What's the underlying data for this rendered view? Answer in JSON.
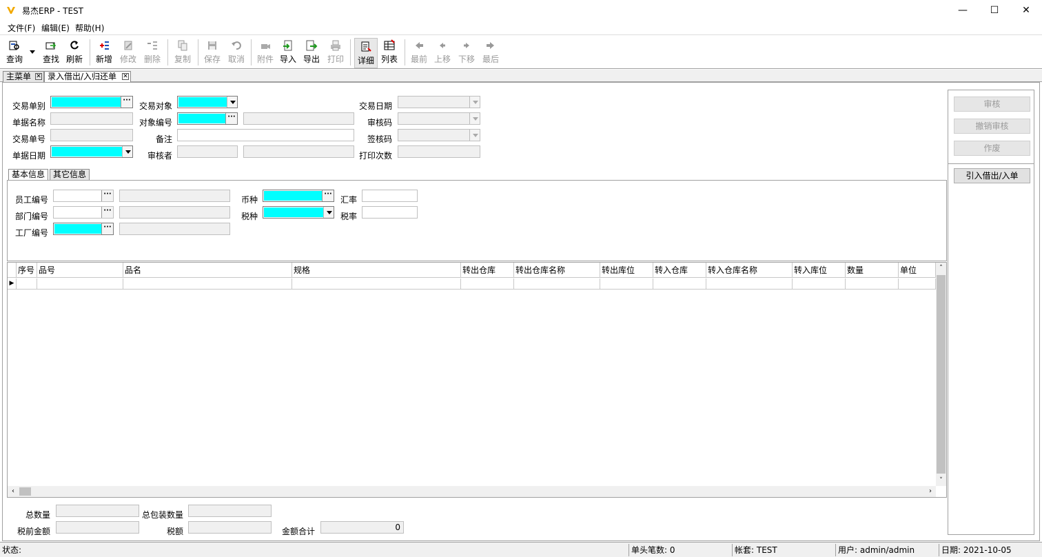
{
  "window": {
    "title": "易杰ERP - TEST",
    "min_glyph": "—",
    "max_glyph": "☐",
    "close_glyph": "✕",
    "brand_color": "#f2a900"
  },
  "menu": [
    "文件(F)",
    "编辑(E)",
    "帮助(H)"
  ],
  "toolbar": {
    "query": "查询",
    "find": "查找",
    "refresh": "刷新",
    "add": "新增",
    "modify": "修改",
    "delete": "删除",
    "copy": "复制",
    "save": "保存",
    "cancel": "取消",
    "attach": "附件",
    "import": "导入",
    "export": "导出",
    "print": "打印",
    "detail": "详细",
    "list": "列表",
    "first": "最前",
    "prev": "上移",
    "next": "下移",
    "last": "最后"
  },
  "doc_tabs": [
    "主菜单",
    "录入借出/入归还单"
  ],
  "header_form": {
    "trade_type": "交易单别",
    "doc_name": "单据名称",
    "trade_no": "交易单号",
    "doc_date": "单据日期",
    "trade_target": "交易对象",
    "target_code": "对象编号",
    "remark": "备注",
    "reviewer": "审核者",
    "trade_date": "交易日期",
    "review_code": "审核码",
    "sign_code": "签核码",
    "print_count": "打印次数"
  },
  "right_panel": {
    "approve": "审核",
    "unapprove": "撤销审核",
    "void": "作废",
    "import_lend": "引入借出/入单"
  },
  "inner_tabs": [
    "基本信息",
    "其它信息"
  ],
  "basic_info": {
    "emp_code": "员工编号",
    "dept_code": "部门编号",
    "factory_code": "工厂编号",
    "currency": "币种",
    "tax_type": "税种",
    "exchange_rate": "汇率",
    "tax_rate": "税率"
  },
  "grid": {
    "columns": [
      "序号",
      "品号",
      "品名",
      "规格",
      "转出仓库",
      "转出仓库名称",
      "转出库位",
      "转入仓库",
      "转入仓库名称",
      "转入库位",
      "数量",
      "单位"
    ],
    "row_indicator": "▶"
  },
  "footer": {
    "total_qty": "总数量",
    "total_pack_qty": "总包装数量",
    "pre_tax_amount": "税前金额",
    "tax": "税额",
    "amount_total": "金额合计",
    "amount_total_value": "0"
  },
  "status": {
    "state": "状态:",
    "header_count": "单头笔数: 0",
    "account": "帐套: TEST",
    "user": "用户: admin/admin",
    "date": "日期: 2021-10-05"
  }
}
